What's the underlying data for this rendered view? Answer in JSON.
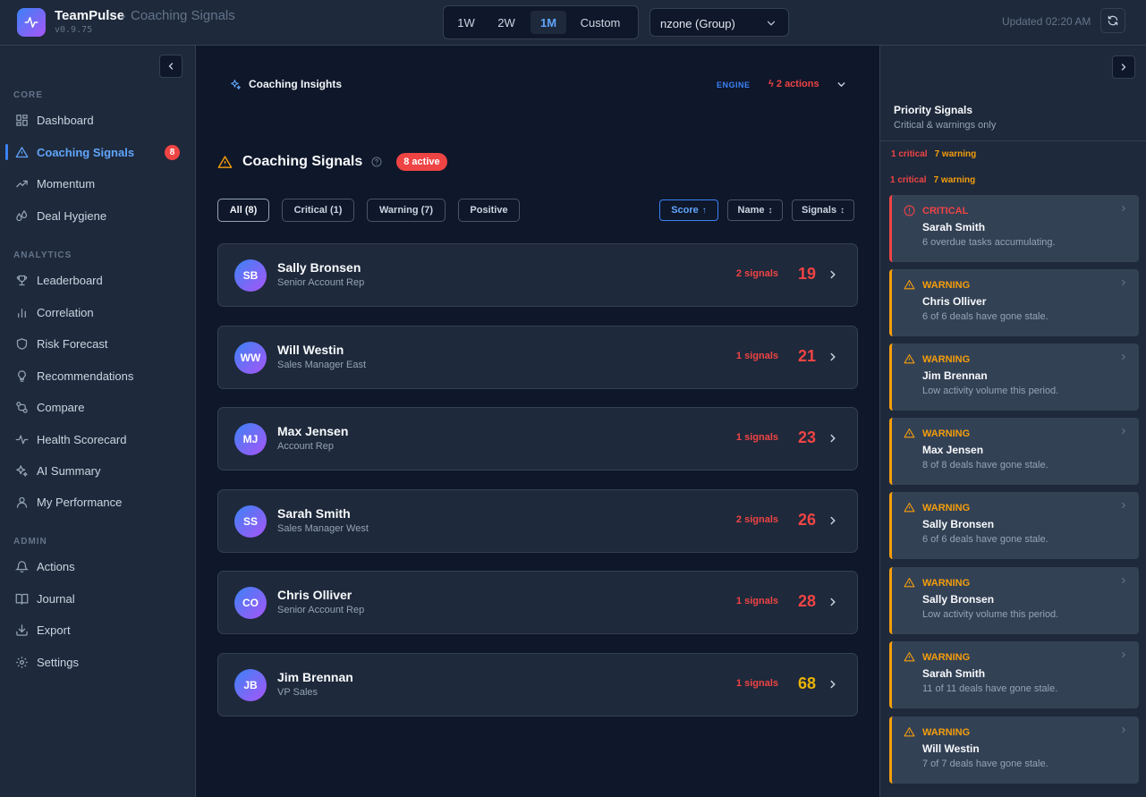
{
  "header": {
    "app_name": "TeamPulse",
    "crumb_sep": "›",
    "crumb": "Coaching Signals",
    "version": "v0.9.75",
    "ranges": [
      "1W",
      "2W",
      "1M",
      "Custom"
    ],
    "active_range": "1M",
    "group_select": "nzone (Group)",
    "updated": "Updated 02:20 AM"
  },
  "sidebar": {
    "sections": [
      {
        "label": "CORE",
        "items": [
          {
            "label": "Dashboard",
            "icon": "grid-icon"
          },
          {
            "label": "Coaching Signals",
            "icon": "warning-icon",
            "active": true,
            "badge": "8"
          },
          {
            "label": "Momentum",
            "icon": "trend-icon"
          },
          {
            "label": "Deal Hygiene",
            "icon": "droplets-icon"
          }
        ]
      },
      {
        "label": "ANALYTICS",
        "items": [
          {
            "label": "Leaderboard",
            "icon": "trophy-icon"
          },
          {
            "label": "Correlation",
            "icon": "bar-chart-icon"
          },
          {
            "label": "Risk Forecast",
            "icon": "shield-icon"
          },
          {
            "label": "Recommendations",
            "icon": "lightbulb-icon"
          },
          {
            "label": "Compare",
            "icon": "compare-icon"
          },
          {
            "label": "Health Scorecard",
            "icon": "pulse-icon"
          },
          {
            "label": "AI Summary",
            "icon": "sparkles-icon"
          },
          {
            "label": "My Performance",
            "icon": "user-icon"
          }
        ]
      },
      {
        "label": "ADMIN",
        "items": [
          {
            "label": "Actions",
            "icon": "bell-icon"
          },
          {
            "label": "Journal",
            "icon": "book-icon"
          },
          {
            "label": "Export",
            "icon": "download-icon"
          },
          {
            "label": "Settings",
            "icon": "gear-icon"
          }
        ]
      }
    ]
  },
  "insights": {
    "title": "Coaching Insights",
    "engine": "ENGINE",
    "actions": "2 actions"
  },
  "signals": {
    "title": "Coaching Signals",
    "active_pill": "8 active",
    "filters": [
      "All (8)",
      "Critical (1)",
      "Warning (7)",
      "Positive"
    ],
    "sorts": [
      {
        "label": "Score",
        "arrow": "↑",
        "active": true
      },
      {
        "label": "Name",
        "arrow": "↕"
      },
      {
        "label": "Signals",
        "arrow": "↕"
      }
    ],
    "reps": [
      {
        "initials": "SB",
        "name": "Sally Bronsen",
        "role": "Senior Account Rep",
        "signals": "2 signals",
        "score": "19",
        "score_color": "#ef4444"
      },
      {
        "initials": "WW",
        "name": "Will Westin",
        "role": "Sales Manager East",
        "signals": "1 signals",
        "score": "21",
        "score_color": "#ef4444"
      },
      {
        "initials": "MJ",
        "name": "Max Jensen",
        "role": "Account Rep",
        "signals": "1 signals",
        "score": "23",
        "score_color": "#ef4444"
      },
      {
        "initials": "SS",
        "name": "Sarah Smith",
        "role": "Sales Manager West",
        "signals": "2 signals",
        "score": "26",
        "score_color": "#ef4444"
      },
      {
        "initials": "CO",
        "name": "Chris Olliver",
        "role": "Senior Account Rep",
        "signals": "1 signals",
        "score": "28",
        "score_color": "#ef4444"
      },
      {
        "initials": "JB",
        "name": "Jim Brennan",
        "role": "VP Sales",
        "signals": "1 signals",
        "score": "68",
        "score_color": "#eab308"
      }
    ]
  },
  "priority": {
    "title": "Priority Signals",
    "subtitle": "Critical & warnings only",
    "critical_count": "1 critical",
    "warning_count": "7 warning",
    "cards": [
      {
        "severity": "CRITICAL",
        "name": "Sarah Smith",
        "desc": "6 overdue tasks accumulating.",
        "critical": true
      },
      {
        "severity": "WARNING",
        "name": "Chris Olliver",
        "desc": "6 of 6 deals have gone stale."
      },
      {
        "severity": "WARNING",
        "name": "Jim Brennan",
        "desc": "Low activity volume this period."
      },
      {
        "severity": "WARNING",
        "name": "Max Jensen",
        "desc": "8 of 8 deals have gone stale."
      },
      {
        "severity": "WARNING",
        "name": "Sally Bronsen",
        "desc": "6 of 6 deals have gone stale."
      },
      {
        "severity": "WARNING",
        "name": "Sally Bronsen",
        "desc": "Low activity volume this period."
      },
      {
        "severity": "WARNING",
        "name": "Sarah Smith",
        "desc": "11 of 11 deals have gone stale."
      },
      {
        "severity": "WARNING",
        "name": "Will Westin",
        "desc": "7 of 7 deals have gone stale."
      }
    ]
  },
  "colors": {
    "accent": "#3b82f6",
    "critical": "#ef4444",
    "warning": "#f59e0b"
  }
}
